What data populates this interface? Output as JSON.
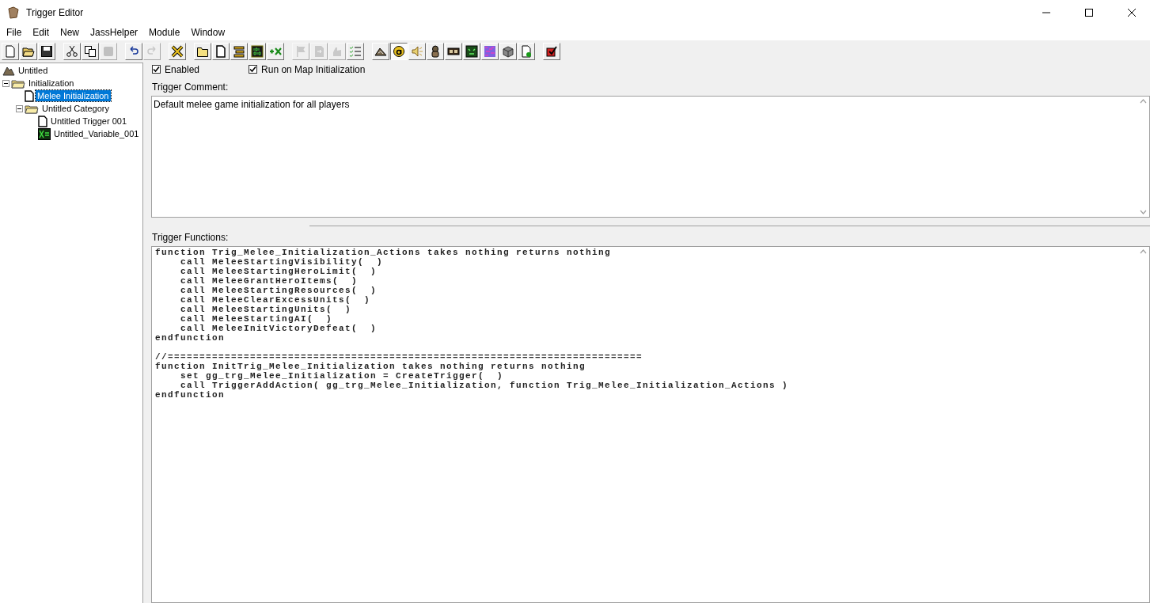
{
  "window": {
    "title": "Trigger Editor"
  },
  "menu": [
    "File",
    "Edit",
    "New",
    "JassHelper",
    "Module",
    "Window"
  ],
  "toolbar": [
    [
      {
        "kind": "new",
        "disabled": false,
        "pressed": false
      },
      {
        "kind": "open",
        "disabled": false,
        "pressed": false
      },
      {
        "kind": "save",
        "disabled": false,
        "pressed": false
      }
    ],
    [
      {
        "kind": "cut",
        "disabled": false,
        "pressed": false
      },
      {
        "kind": "copy",
        "disabled": false,
        "pressed": false
      },
      {
        "kind": "paste",
        "disabled": true,
        "pressed": false
      }
    ],
    [
      {
        "kind": "undo",
        "disabled": false,
        "pressed": false
      },
      {
        "kind": "redo",
        "disabled": true,
        "pressed": false
      }
    ],
    [
      {
        "kind": "cross",
        "disabled": false,
        "pressed": false
      }
    ],
    [
      {
        "kind": "folder",
        "disabled": false,
        "pressed": false
      },
      {
        "kind": "page",
        "disabled": false,
        "pressed": false
      },
      {
        "kind": "bars",
        "disabled": false,
        "pressed": false
      },
      {
        "kind": "binary",
        "disabled": false,
        "pressed": false
      },
      {
        "kind": "plusx",
        "disabled": false,
        "pressed": false
      }
    ],
    [
      {
        "kind": "flag",
        "disabled": true,
        "pressed": false
      },
      {
        "kind": "import",
        "disabled": true,
        "pressed": false
      },
      {
        "kind": "hand",
        "disabled": true,
        "pressed": false
      },
      {
        "kind": "checklist",
        "disabled": false,
        "pressed": false
      }
    ],
    [
      {
        "kind": "terrain",
        "disabled": false,
        "pressed": false
      },
      {
        "kind": "letter",
        "disabled": false,
        "pressed": true
      },
      {
        "kind": "speaker",
        "disabled": false,
        "pressed": false
      },
      {
        "kind": "figure",
        "disabled": false,
        "pressed": false
      },
      {
        "kind": "film",
        "disabled": false,
        "pressed": false
      },
      {
        "kind": "monster",
        "disabled": false,
        "pressed": false
      },
      {
        "kind": "noise",
        "disabled": false,
        "pressed": false
      },
      {
        "kind": "cube",
        "disabled": false,
        "pressed": false
      },
      {
        "kind": "pageplus",
        "disabled": false,
        "pressed": false
      }
    ],
    [
      {
        "kind": "redcheck",
        "disabled": false,
        "pressed": false
      }
    ]
  ],
  "tree": {
    "label": "Untitled",
    "kind": "map",
    "selected": false,
    "children": [
      {
        "label": "Initialization",
        "kind": "folder",
        "expanded": true,
        "selected": false,
        "children": [
          {
            "label": "Melee Initialization",
            "kind": "trigger",
            "selected": true
          },
          {
            "label": "Untitled Category",
            "kind": "folder",
            "expanded": true,
            "selected": false,
            "children": [
              {
                "label": "Untitled Trigger 001",
                "kind": "trigger",
                "selected": false
              },
              {
                "label": "Untitled_Variable_001",
                "kind": "variable",
                "selected": false
              }
            ]
          }
        ]
      }
    ]
  },
  "options": [
    {
      "label": "Enabled",
      "checked": true
    },
    {
      "label": "Run on Map Initialization",
      "checked": true
    }
  ],
  "comment": {
    "label": "Trigger Comment:",
    "value": "Default melee game initialization for all players"
  },
  "functions": {
    "label": "Trigger Functions:",
    "blocks": [
      [
        "function Trig_Melee_Initialization_Actions takes nothing returns nothing",
        "    call MeleeStartingVisibility(  )",
        "    call MeleeStartingHeroLimit(  )",
        "    call MeleeGrantHeroItems(  )",
        "    call MeleeStartingResources(  )",
        "    call MeleeClearExcessUnits(  )",
        "    call MeleeStartingUnits(  )",
        "    call MeleeStartingAI(  )",
        "    call MeleeInitVictoryDefeat(  )",
        "endfunction"
      ],
      [
        "//===========================================================================",
        "function InitTrig_Melee_Initialization takes nothing returns nothing",
        "    set gg_trg_Melee_Initialization = CreateTrigger(  )",
        "    call TriggerAddAction( gg_trg_Melee_Initialization, function Trig_Melee_Initialization_Actions )",
        "endfunction"
      ]
    ]
  }
}
